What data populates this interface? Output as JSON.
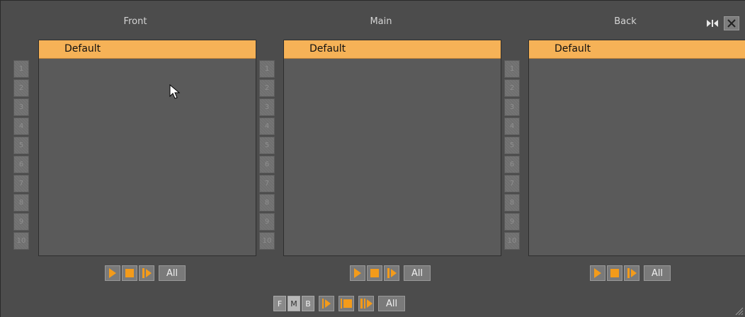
{
  "columns": [
    {
      "title": "Front",
      "layer": "Default"
    },
    {
      "title": "Main",
      "layer": "Default"
    },
    {
      "title": "Back",
      "layer": "Default"
    }
  ],
  "numbers": [
    "1",
    "2",
    "3",
    "4",
    "5",
    "6",
    "7",
    "8",
    "9",
    "10"
  ],
  "controls": {
    "all_label": "All"
  },
  "bottom": {
    "f": "F",
    "m": "M",
    "b": "B",
    "all_label": "All"
  },
  "icons": {
    "play": "play-icon",
    "stop": "stop-icon",
    "continue": "continue-icon",
    "close": "close-icon",
    "dock": "dock-icon"
  },
  "colors": {
    "accent": "#f6b257",
    "icon": "#f39b1a",
    "background": "#4c4c4c"
  }
}
